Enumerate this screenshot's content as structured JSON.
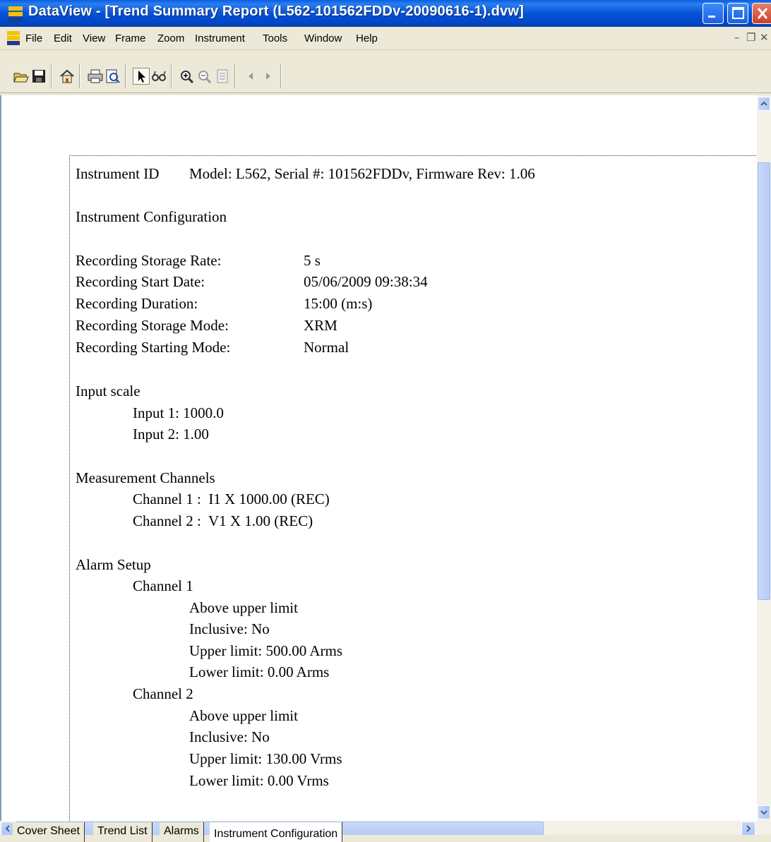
{
  "window": {
    "title": "DataView - [Trend Summary Report (L562-101562FDDv-20090616-1).dvw]"
  },
  "menu": [
    "File",
    "Edit",
    "View",
    "Frame",
    "Zoom",
    "Instrument",
    "Tools",
    "Window",
    "Help"
  ],
  "toolbar": {
    "buttons": [
      "open-icon",
      "save-icon",
      "home-icon",
      "print-icon",
      "print-preview-icon",
      "select-arrow-icon",
      "glasses-icon",
      "zoom-in-icon",
      "zoom-out-icon",
      "page-icon",
      "prev-icon",
      "next-icon"
    ]
  },
  "report": {
    "instrument_id_label": "Instrument ID",
    "instrument_id_value": "Model: L562, Serial #: 101562FDDv, Firmware Rev: 1.06",
    "config_heading": "Instrument Configuration",
    "config": [
      {
        "label": "Recording Storage Rate:",
        "value": "5 s"
      },
      {
        "label": "Recording Start Date:",
        "value": "05/06/2009 09:38:34"
      },
      {
        "label": "Recording Duration:",
        "value": "15:00 (m:s)"
      },
      {
        "label": "Recording Storage Mode:",
        "value": "XRM"
      },
      {
        "label": "Recording Starting Mode:",
        "value": "Normal"
      }
    ],
    "input_scale_heading": "Input scale",
    "input_scale": [
      "Input 1: 1000.0",
      "Input 2: 1.00"
    ],
    "channels_heading": "Measurement Channels",
    "channels": [
      "Channel 1 :  I1 X 1000.00 (REC)",
      "Channel 2 :  V1 X 1.00 (REC)"
    ],
    "alarm_heading": "Alarm Setup",
    "alarms": [
      {
        "name": "Channel 1",
        "lines": [
          "Above upper limit",
          "Inclusive: No",
          "Upper limit: 500.00 Arms",
          "Lower limit: 0.00 Arms"
        ]
      },
      {
        "name": "Channel 2",
        "lines": [
          "Above upper limit",
          "Inclusive: No",
          "Upper limit: 130.00 Vrms",
          "Lower limit: 0.00 Vrms"
        ]
      }
    ]
  },
  "tabs": [
    "Cover Sheet",
    "Trend List",
    "Alarms",
    "Instrument Configuration"
  ],
  "active_tab": "Instrument Configuration"
}
